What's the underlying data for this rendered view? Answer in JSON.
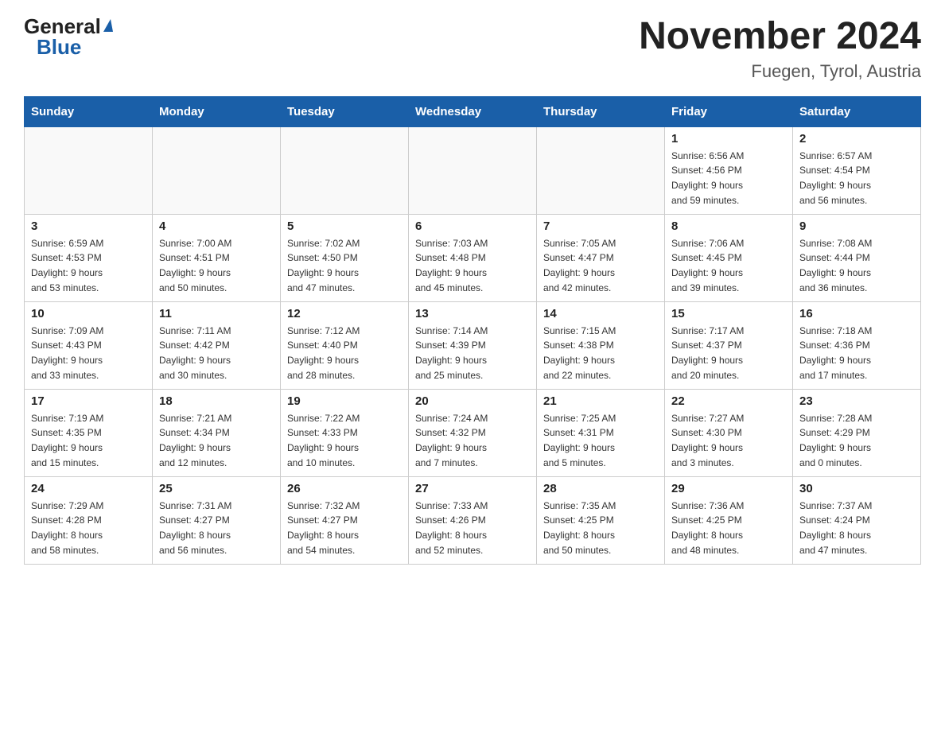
{
  "header": {
    "month_title": "November 2024",
    "location": "Fuegen, Tyrol, Austria",
    "logo_general": "General",
    "logo_blue": "Blue"
  },
  "weekdays": [
    "Sunday",
    "Monday",
    "Tuesday",
    "Wednesday",
    "Thursday",
    "Friday",
    "Saturday"
  ],
  "weeks": [
    [
      {
        "day": "",
        "info": ""
      },
      {
        "day": "",
        "info": ""
      },
      {
        "day": "",
        "info": ""
      },
      {
        "day": "",
        "info": ""
      },
      {
        "day": "",
        "info": ""
      },
      {
        "day": "1",
        "info": "Sunrise: 6:56 AM\nSunset: 4:56 PM\nDaylight: 9 hours\nand 59 minutes."
      },
      {
        "day": "2",
        "info": "Sunrise: 6:57 AM\nSunset: 4:54 PM\nDaylight: 9 hours\nand 56 minutes."
      }
    ],
    [
      {
        "day": "3",
        "info": "Sunrise: 6:59 AM\nSunset: 4:53 PM\nDaylight: 9 hours\nand 53 minutes."
      },
      {
        "day": "4",
        "info": "Sunrise: 7:00 AM\nSunset: 4:51 PM\nDaylight: 9 hours\nand 50 minutes."
      },
      {
        "day": "5",
        "info": "Sunrise: 7:02 AM\nSunset: 4:50 PM\nDaylight: 9 hours\nand 47 minutes."
      },
      {
        "day": "6",
        "info": "Sunrise: 7:03 AM\nSunset: 4:48 PM\nDaylight: 9 hours\nand 45 minutes."
      },
      {
        "day": "7",
        "info": "Sunrise: 7:05 AM\nSunset: 4:47 PM\nDaylight: 9 hours\nand 42 minutes."
      },
      {
        "day": "8",
        "info": "Sunrise: 7:06 AM\nSunset: 4:45 PM\nDaylight: 9 hours\nand 39 minutes."
      },
      {
        "day": "9",
        "info": "Sunrise: 7:08 AM\nSunset: 4:44 PM\nDaylight: 9 hours\nand 36 minutes."
      }
    ],
    [
      {
        "day": "10",
        "info": "Sunrise: 7:09 AM\nSunset: 4:43 PM\nDaylight: 9 hours\nand 33 minutes."
      },
      {
        "day": "11",
        "info": "Sunrise: 7:11 AM\nSunset: 4:42 PM\nDaylight: 9 hours\nand 30 minutes."
      },
      {
        "day": "12",
        "info": "Sunrise: 7:12 AM\nSunset: 4:40 PM\nDaylight: 9 hours\nand 28 minutes."
      },
      {
        "day": "13",
        "info": "Sunrise: 7:14 AM\nSunset: 4:39 PM\nDaylight: 9 hours\nand 25 minutes."
      },
      {
        "day": "14",
        "info": "Sunrise: 7:15 AM\nSunset: 4:38 PM\nDaylight: 9 hours\nand 22 minutes."
      },
      {
        "day": "15",
        "info": "Sunrise: 7:17 AM\nSunset: 4:37 PM\nDaylight: 9 hours\nand 20 minutes."
      },
      {
        "day": "16",
        "info": "Sunrise: 7:18 AM\nSunset: 4:36 PM\nDaylight: 9 hours\nand 17 minutes."
      }
    ],
    [
      {
        "day": "17",
        "info": "Sunrise: 7:19 AM\nSunset: 4:35 PM\nDaylight: 9 hours\nand 15 minutes."
      },
      {
        "day": "18",
        "info": "Sunrise: 7:21 AM\nSunset: 4:34 PM\nDaylight: 9 hours\nand 12 minutes."
      },
      {
        "day": "19",
        "info": "Sunrise: 7:22 AM\nSunset: 4:33 PM\nDaylight: 9 hours\nand 10 minutes."
      },
      {
        "day": "20",
        "info": "Sunrise: 7:24 AM\nSunset: 4:32 PM\nDaylight: 9 hours\nand 7 minutes."
      },
      {
        "day": "21",
        "info": "Sunrise: 7:25 AM\nSunset: 4:31 PM\nDaylight: 9 hours\nand 5 minutes."
      },
      {
        "day": "22",
        "info": "Sunrise: 7:27 AM\nSunset: 4:30 PM\nDaylight: 9 hours\nand 3 minutes."
      },
      {
        "day": "23",
        "info": "Sunrise: 7:28 AM\nSunset: 4:29 PM\nDaylight: 9 hours\nand 0 minutes."
      }
    ],
    [
      {
        "day": "24",
        "info": "Sunrise: 7:29 AM\nSunset: 4:28 PM\nDaylight: 8 hours\nand 58 minutes."
      },
      {
        "day": "25",
        "info": "Sunrise: 7:31 AM\nSunset: 4:27 PM\nDaylight: 8 hours\nand 56 minutes."
      },
      {
        "day": "26",
        "info": "Sunrise: 7:32 AM\nSunset: 4:27 PM\nDaylight: 8 hours\nand 54 minutes."
      },
      {
        "day": "27",
        "info": "Sunrise: 7:33 AM\nSunset: 4:26 PM\nDaylight: 8 hours\nand 52 minutes."
      },
      {
        "day": "28",
        "info": "Sunrise: 7:35 AM\nSunset: 4:25 PM\nDaylight: 8 hours\nand 50 minutes."
      },
      {
        "day": "29",
        "info": "Sunrise: 7:36 AM\nSunset: 4:25 PM\nDaylight: 8 hours\nand 48 minutes."
      },
      {
        "day": "30",
        "info": "Sunrise: 7:37 AM\nSunset: 4:24 PM\nDaylight: 8 hours\nand 47 minutes."
      }
    ]
  ]
}
